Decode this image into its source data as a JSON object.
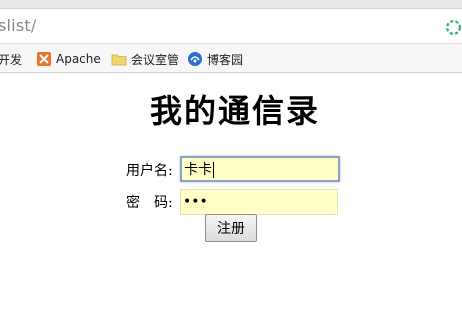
{
  "browser": {
    "address_text": "slist/"
  },
  "bookmarks": [
    {
      "label": "开发",
      "icon": "folder-icon"
    },
    {
      "label": "Apache",
      "icon": "apache-icon"
    },
    {
      "label": "会议室管",
      "icon": "folder-icon"
    },
    {
      "label": "博客园",
      "icon": "cnblogs-icon"
    }
  ],
  "page": {
    "title": "我的通信录",
    "username_label": "用户名:",
    "username_value": "卡卡",
    "password_label": "密　码:",
    "password_value": "•••",
    "submit_label": "注册"
  }
}
